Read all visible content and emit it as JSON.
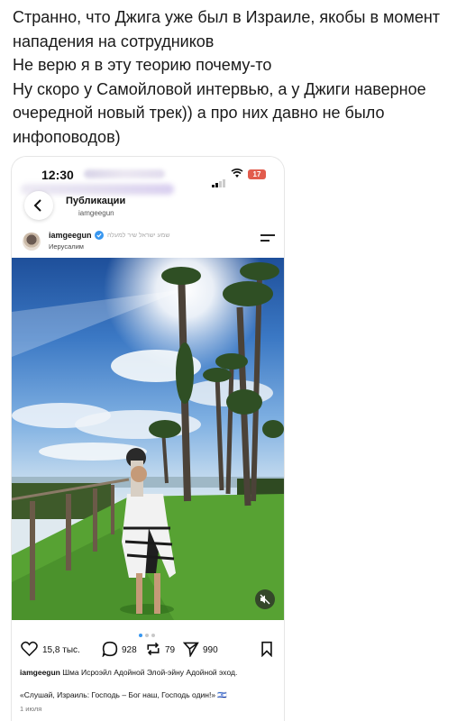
{
  "message": {
    "lines": [
      "Странно, что Джига уже был в Израиле, якобы в момент нападения на сотрудников",
      "Не верю я в эту теорию почему-то",
      "Ну скоро у Самойловой интервью, а у Джиги наверное очередной новый трек)) а про них давно не было инфоповодов)"
    ]
  },
  "screenshot": {
    "status_bar": {
      "time": "12:30",
      "battery": "17"
    },
    "header": {
      "title": "Публикации",
      "subtitle": "iamgeegun"
    },
    "post": {
      "username": "iamgeegun",
      "music": "שמע ישראל שיר למעלה",
      "location": "Иерусалим",
      "likes": "15,8 тыс.",
      "comments": "928",
      "reposts": "79",
      "shares": "990",
      "caption_user": "iamgeegun",
      "caption_text": "Шма Исроэйл Адойной Элой-эйну Адойной эход.",
      "quote": "«Слушай, Израиль: Господь – Бог наш, Господь один!» 🇮🇱",
      "date": "1 июля",
      "carousel_pages": 3,
      "carousel_active": 1
    },
    "icons": [
      "back-chevron-icon",
      "verified-icon",
      "menu-icon",
      "mute-icon",
      "heart-icon",
      "comment-icon",
      "repost-icon",
      "send-icon",
      "bookmark-icon"
    ],
    "colors": {
      "accent": "#3897f0",
      "battery": "#e25c4d"
    }
  }
}
